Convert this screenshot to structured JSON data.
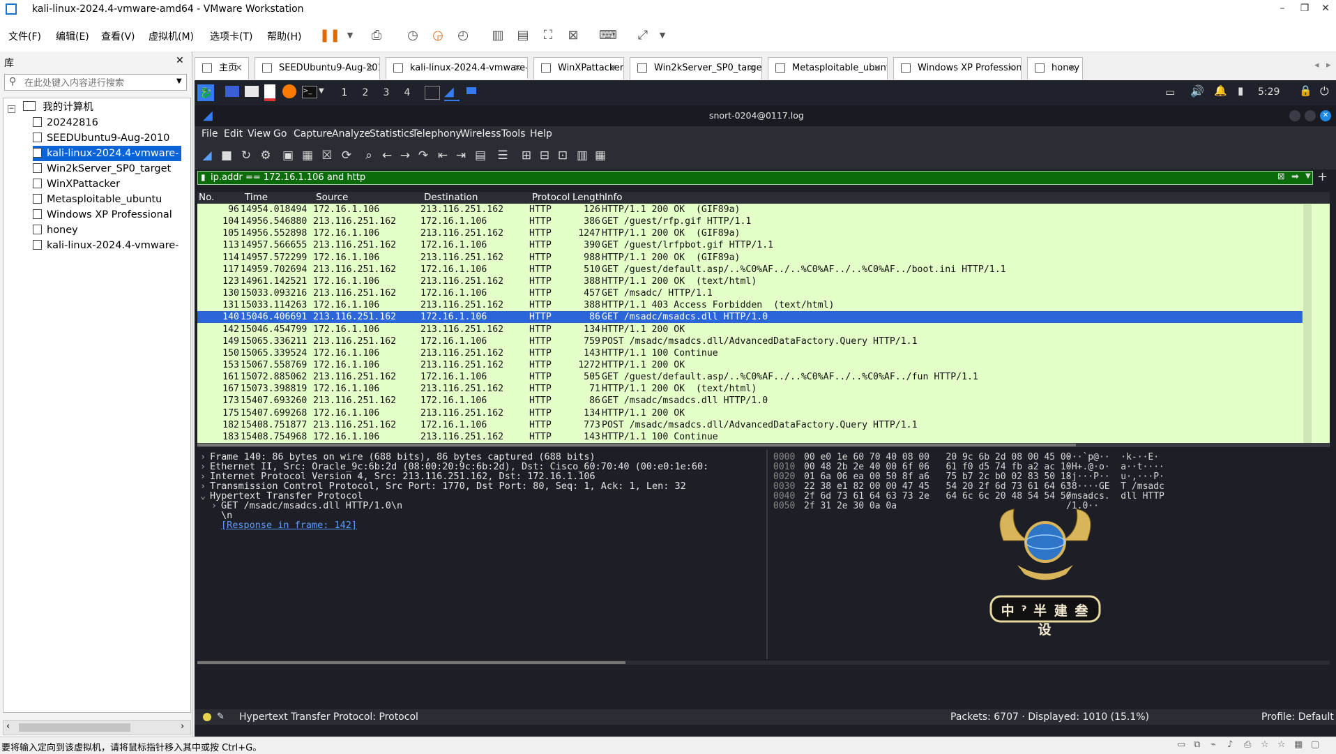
{
  "window": {
    "title": "kali-linux-2024.4-vmware-amd64 - VMware Workstation",
    "min": "–",
    "max": "❐",
    "close": "✕"
  },
  "menu": [
    "文件(F)",
    "编辑(E)",
    "查看(V)",
    "虚拟机(M)",
    "选项卡(T)",
    "帮助(H)"
  ],
  "library": {
    "title": "库",
    "close": "✕",
    "search_placeholder": "在此处键入内容进行搜索",
    "root": "我的计算机",
    "items": [
      "20242816",
      "SEEDUbuntu9-Aug-2010",
      "kali-linux-2024.4-vmware-",
      "Win2kServer_SP0_target",
      "WinXPattacker",
      "Metasploitable_ubuntu",
      "Windows XP Professional",
      "honey",
      "kali-linux-2024.4-vmware-"
    ],
    "selected_index": 2
  },
  "tabs": [
    "主页",
    "SEEDUbuntu9-Aug-2010",
    "kali-linux-2024.4-vmware-a...",
    "WinXPattacker",
    "Win2kServer_SP0_target",
    "Metasploitable_ubuntu",
    "Windows XP Professional",
    "honey"
  ],
  "active_tab": 2,
  "kali": {
    "workspaces": [
      "1",
      "2",
      "3",
      "4"
    ],
    "clock": "5:29"
  },
  "wireshark": {
    "title": "snort-0204@0117.log",
    "menu": [
      "File",
      "Edit",
      "View",
      "Go",
      "Capture",
      "Analyze",
      "Statistics",
      "Telephony",
      "Wireless",
      "Tools",
      "Help"
    ],
    "filter": "ip.addr == 172.16.1.106 and http",
    "columns": [
      "No.",
      "Time",
      "Source",
      "Destination",
      "Protocol",
      "Length",
      "Info"
    ],
    "packets": [
      [
        "96",
        "14954.018494",
        "172.16.1.106",
        "213.116.251.162",
        "HTTP",
        "126",
        "HTTP/1.1 200 OK  (GIF89a)"
      ],
      [
        "104",
        "14956.546880",
        "213.116.251.162",
        "172.16.1.106",
        "HTTP",
        "386",
        "GET /guest/rfp.gif HTTP/1.1"
      ],
      [
        "105",
        "14956.552898",
        "172.16.1.106",
        "213.116.251.162",
        "HTTP",
        "1247",
        "HTTP/1.1 200 OK  (GIF89a)"
      ],
      [
        "113",
        "14957.566655",
        "213.116.251.162",
        "172.16.1.106",
        "HTTP",
        "390",
        "GET /guest/lrfpbot.gif HTTP/1.1"
      ],
      [
        "114",
        "14957.572299",
        "172.16.1.106",
        "213.116.251.162",
        "HTTP",
        "988",
        "HTTP/1.1 200 OK  (GIF89a)"
      ],
      [
        "117",
        "14959.702694",
        "213.116.251.162",
        "172.16.1.106",
        "HTTP",
        "510",
        "GET /guest/default.asp/..%C0%AF../..%C0%AF../..%C0%AF../boot.ini HTTP/1.1"
      ],
      [
        "123",
        "14961.142521",
        "172.16.1.106",
        "213.116.251.162",
        "HTTP",
        "388",
        "HTTP/1.1 200 OK  (text/html)"
      ],
      [
        "130",
        "15033.093216",
        "213.116.251.162",
        "172.16.1.106",
        "HTTP",
        "457",
        "GET /msadc/ HTTP/1.1"
      ],
      [
        "131",
        "15033.114263",
        "172.16.1.106",
        "213.116.251.162",
        "HTTP",
        "388",
        "HTTP/1.1 403 Access Forbidden  (text/html)"
      ],
      [
        "140",
        "15046.406691",
        "213.116.251.162",
        "172.16.1.106",
        "HTTP",
        "86",
        "GET /msadc/msadcs.dll HTTP/1.0"
      ],
      [
        "142",
        "15046.454799",
        "172.16.1.106",
        "213.116.251.162",
        "HTTP",
        "134",
        "HTTP/1.1 200 OK"
      ],
      [
        "149",
        "15065.336211",
        "213.116.251.162",
        "172.16.1.106",
        "HTTP",
        "759",
        "POST /msadc/msadcs.dll/AdvancedDataFactory.Query HTTP/1.1"
      ],
      [
        "150",
        "15065.339524",
        "172.16.1.106",
        "213.116.251.162",
        "HTTP",
        "143",
        "HTTP/1.1 100 Continue"
      ],
      [
        "153",
        "15067.558769",
        "172.16.1.106",
        "213.116.251.162",
        "HTTP",
        "1272",
        "HTTP/1.1 200 OK"
      ],
      [
        "161",
        "15072.885062",
        "213.116.251.162",
        "172.16.1.106",
        "HTTP",
        "505",
        "GET /guest/default.asp/..%C0%AF../..%C0%AF../..%C0%AF../fun HTTP/1.1"
      ],
      [
        "167",
        "15073.398819",
        "172.16.1.106",
        "213.116.251.162",
        "HTTP",
        "71",
        "HTTP/1.1 200 OK  (text/html)"
      ],
      [
        "173",
        "15407.693260",
        "213.116.251.162",
        "172.16.1.106",
        "HTTP",
        "86",
        "GET /msadc/msadcs.dll HTTP/1.0"
      ],
      [
        "175",
        "15407.699268",
        "172.16.1.106",
        "213.116.251.162",
        "HTTP",
        "134",
        "HTTP/1.1 200 OK"
      ],
      [
        "182",
        "15408.751877",
        "213.116.251.162",
        "172.16.1.106",
        "HTTP",
        "773",
        "POST /msadc/msadcs.dll/AdvancedDataFactory.Query HTTP/1.1"
      ],
      [
        "183",
        "15408.754968",
        "172.16.1.106",
        "213.116.251.162",
        "HTTP",
        "143",
        "HTTP/1.1 100 Continue"
      ]
    ],
    "selected_packet": 9,
    "details": [
      {
        "arrow": "›",
        "text": "Frame 140: 86 bytes on wire (688 bits), 86 bytes captured (688 bits)",
        "indent": 0
      },
      {
        "arrow": "›",
        "text": "Ethernet II, Src: Oracle_9c:6b:2d (08:00:20:9c:6b:2d), Dst: Cisco_60:70:40 (00:e0:1e:60:",
        "indent": 0
      },
      {
        "arrow": "›",
        "text": "Internet Protocol Version 4, Src: 213.116.251.162, Dst: 172.16.1.106",
        "indent": 0
      },
      {
        "arrow": "›",
        "text": "Transmission Control Protocol, Src Port: 1770, Dst Port: 80, Seq: 1, Ack: 1, Len: 32",
        "indent": 0
      },
      {
        "arrow": "⌄",
        "text": "Hypertext Transfer Protocol",
        "indent": 0
      },
      {
        "arrow": "›",
        "text": "GET /msadc/msadcs.dll HTTP/1.0\\n",
        "indent": 1
      },
      {
        "arrow": "",
        "text": "\\n",
        "indent": 1
      },
      {
        "arrow": "",
        "text": "[Response in frame: 142]",
        "indent": 1,
        "link": true
      }
    ],
    "bytes": [
      {
        "off": "0000",
        "hex": "00 e0 1e 60 70 40 08 00   20 9c 6b 2d 08 00 45 00",
        "ascii": "···`p@··  ·k-··E·"
      },
      {
        "off": "0010",
        "hex": "00 48 2b 2e 40 00 6f 06   61 f0 d5 74 fb a2 ac 10",
        "ascii": "·H+.@·o·  a··t····"
      },
      {
        "off": "0020",
        "hex": "01 6a 06 ea 00 50 8f a6   75 b7 2c b0 02 83 50 18",
        "ascii": "·j···P··  u·,···P·"
      },
      {
        "off": "0030",
        "hex": "22 38 e1 82 00 00 47 45   54 20 2f 6d 73 61 64 63",
        "ascii": "\"8····GE  T /msadc"
      },
      {
        "off": "0040",
        "hex": "2f 6d 73 61 64 63 73 2e   64 6c 6c 20 48 54 54 50",
        "ascii": "/msadcs.  dll HTTP"
      },
      {
        "off": "0050",
        "hex": "2f 31 2e 30 0a 0a",
        "ascii": "/1.0··"
      }
    ],
    "status_field": "Hypertext Transfer Protocol: Protocol",
    "status_packets": "Packets: 6707 · Displayed: 1010 (15.1%)",
    "status_profile": "Profile: Default"
  },
  "watermark": "中 ˀ 半 建 叁 设",
  "vm_status_hint": "要将输入定向到该虚拟机，请将鼠标指针移入其中或按 Ctrl+G。",
  "colors": {
    "row_green": "#e4ffc7",
    "row_selected": "#2a66d9",
    "filter_ok": "#0b6b0b",
    "ws_dark": "#2b2d35"
  }
}
